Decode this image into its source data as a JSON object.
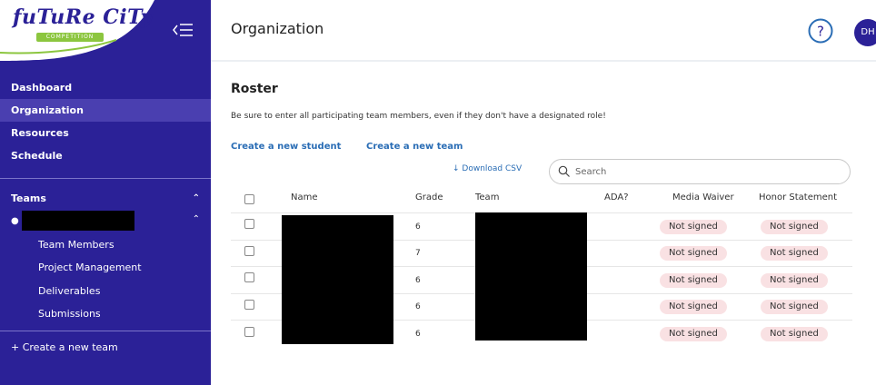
{
  "sidebar": {
    "logo_text": "fuTuRe CiTy",
    "logo_sub": "COMPETITION",
    "nav": [
      {
        "label": "Dashboard"
      },
      {
        "label": "Organization"
      },
      {
        "label": "Resources"
      },
      {
        "label": "Schedule"
      }
    ],
    "teams_label": "Teams",
    "team_sub_items": [
      {
        "label": "Team Members"
      },
      {
        "label": "Project Management"
      },
      {
        "label": "Deliverables"
      },
      {
        "label": "Submissions"
      }
    ],
    "create_team_label": "+ Create a new team",
    "colors": {
      "bg": "#2b2197",
      "active": "#4a3fb0",
      "accent": "#8cc63f"
    }
  },
  "header": {
    "title": "Organization",
    "help_icon": "question-circle-icon",
    "avatar_initials": "DH"
  },
  "main": {
    "section_title": "Roster",
    "help_text": "Be sure to enter all participating team members, even if they don't have a designated role!",
    "create_student_label": "Create a new student",
    "create_team_label": "Create a new team",
    "download_label": "↓ Download CSV",
    "search_placeholder": "Search",
    "columns": [
      "Name",
      "Grade",
      "Team",
      "ADA?",
      "Media Waiver",
      "Honor Statement"
    ],
    "rows": [
      {
        "grade": "6",
        "media": "Not signed",
        "honor": "Not signed"
      },
      {
        "grade": "7",
        "media": "Not signed",
        "honor": "Not signed"
      },
      {
        "grade": "6",
        "media": "Not signed",
        "honor": "Not signed"
      },
      {
        "grade": "6",
        "media": "Not signed",
        "honor": "Not signed"
      },
      {
        "grade": "6",
        "media": "Not signed",
        "honor": "Not signed"
      }
    ],
    "colors": {
      "link": "#2a6db5",
      "badge_bg": "#f9e1e3"
    }
  }
}
